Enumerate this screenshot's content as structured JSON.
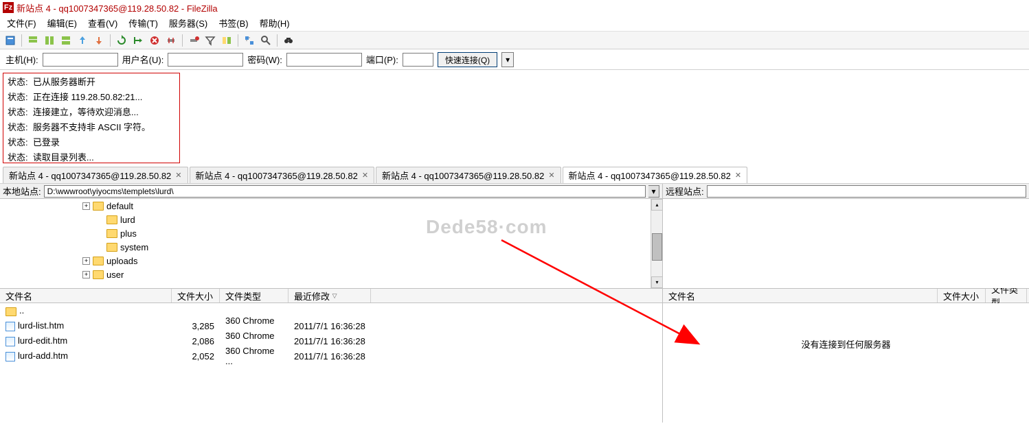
{
  "app": {
    "title": "新站点 4 - qq1007347365@119.28.50.82 - FileZilla"
  },
  "menu": {
    "file": "文件(F)",
    "edit": "编辑(E)",
    "view": "查看(V)",
    "transfer": "传输(T)",
    "server": "服务器(S)",
    "bookmarks": "书签(B)",
    "help": "帮助(H)"
  },
  "quickconnect": {
    "host_label": "主机(H):",
    "user_label": "用户名(U):",
    "pass_label": "密码(W):",
    "port_label": "端口(P):",
    "connect_btn": "快速连接(Q)"
  },
  "log": {
    "label": "状态:",
    "lines": [
      "已从服务器断开",
      "正在连接 119.28.50.82:21...",
      "连接建立，等待欢迎消息...",
      "服务器不支持非 ASCII 字符。",
      "已登录",
      "读取目录列表..."
    ]
  },
  "tabs": [
    "新站点 4 - qq1007347365@119.28.50.82",
    "新站点 4 - qq1007347365@119.28.50.82",
    "新站点 4 - qq1007347365@119.28.50.82",
    "新站点 4 - qq1007347365@119.28.50.82"
  ],
  "local": {
    "site_label": "本地站点:",
    "path": "D:\\wwwroot\\yiyocms\\templets\\lurd\\",
    "tree": [
      {
        "name": "default",
        "indent": 120,
        "expander": "+"
      },
      {
        "name": "lurd",
        "indent": 140,
        "expander": ""
      },
      {
        "name": "plus",
        "indent": 140,
        "expander": ""
      },
      {
        "name": "system",
        "indent": 140,
        "expander": ""
      },
      {
        "name": "uploads",
        "indent": 120,
        "expander": "+"
      },
      {
        "name": "user",
        "indent": 120,
        "expander": "+"
      }
    ],
    "cols": {
      "name": "文件名",
      "size": "文件大小",
      "type": "文件类型",
      "modified": "最近修改"
    },
    "files": [
      {
        "name": "..",
        "size": "",
        "type": "",
        "modified": "",
        "icon": "updir"
      },
      {
        "name": "lurd-list.htm",
        "size": "3,285",
        "type": "360 Chrome ...",
        "modified": "2011/7/1 16:36:28",
        "icon": "htm"
      },
      {
        "name": "lurd-edit.htm",
        "size": "2,086",
        "type": "360 Chrome ...",
        "modified": "2011/7/1 16:36:28",
        "icon": "htm"
      },
      {
        "name": "lurd-add.htm",
        "size": "2,052",
        "type": "360 Chrome ...",
        "modified": "2011/7/1 16:36:28",
        "icon": "htm"
      }
    ]
  },
  "remote": {
    "site_label": "远程站点:",
    "cols": {
      "name": "文件名",
      "size": "文件大小",
      "type": "文件类型"
    },
    "empty_msg": "没有连接到任何服务器"
  },
  "watermark": "Dede58·com"
}
